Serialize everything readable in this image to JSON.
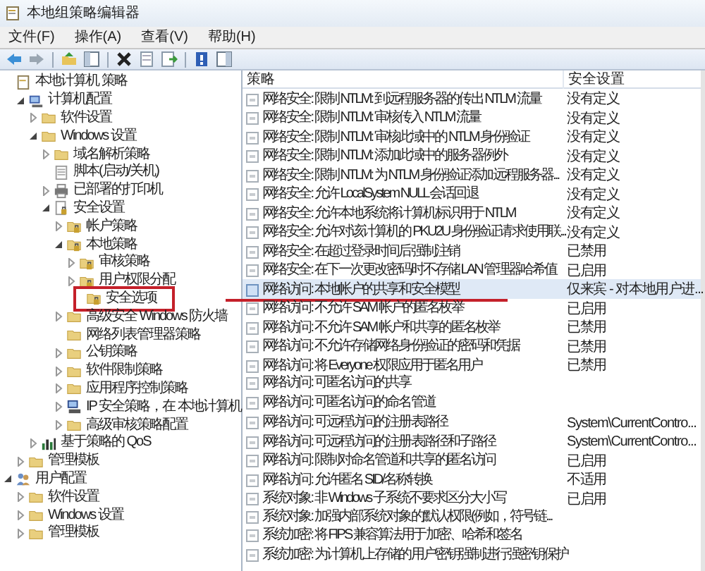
{
  "window": {
    "title": "本地组策略编辑器"
  },
  "menu": [
    "文件(F)",
    "操作(A)",
    "查看(V)",
    "帮助(H)"
  ],
  "toolbar": [
    {
      "kind": "back"
    },
    {
      "kind": "forward"
    },
    {
      "kind": "sep"
    },
    {
      "kind": "up"
    },
    {
      "kind": "tree"
    },
    {
      "kind": "sep"
    },
    {
      "kind": "delete"
    },
    {
      "kind": "properties"
    },
    {
      "kind": "export"
    },
    {
      "kind": "sep"
    },
    {
      "kind": "help"
    },
    {
      "kind": "pane"
    }
  ],
  "tree": [
    {
      "label": "本地计算机 策略",
      "kind": "root",
      "children": [
        {
          "label": "计算机配置",
          "kind": "computer",
          "expanded": true,
          "children": [
            {
              "label": "软件设置",
              "kind": "folder",
              "expanded": false
            },
            {
              "label": "Windows 设置",
              "kind": "folder",
              "expanded": true,
              "children": [
                {
                  "label": "域名解析策略",
                  "kind": "folder",
                  "expanded": false
                },
                {
                  "label": "脚本(启动/关机)",
                  "kind": "script"
                },
                {
                  "label": "已部署的打印机",
                  "kind": "printer",
                  "expanded": false
                },
                {
                  "label": "安全设置",
                  "kind": "secure",
                  "expanded": true,
                  "children": [
                    {
                      "label": "帐户策略",
                      "kind": "secure-folder",
                      "expanded": false
                    },
                    {
                      "label": "本地策略",
                      "kind": "secure-folder",
                      "expanded": true,
                      "children": [
                        {
                          "label": "审核策略",
                          "kind": "secure-folder",
                          "expanded": false
                        },
                        {
                          "label": "用户权限分配",
                          "kind": "secure-folder",
                          "expanded": false
                        },
                        {
                          "label": "安全选项",
                          "kind": "secure-folder",
                          "annotated": true
                        }
                      ]
                    },
                    {
                      "label": "高级安全 Windows 防火墙",
                      "kind": "folder",
                      "expanded": false
                    },
                    {
                      "label": "网络列表管理器策略",
                      "kind": "folder"
                    },
                    {
                      "label": "公钥策略",
                      "kind": "folder",
                      "expanded": false
                    },
                    {
                      "label": "软件限制策略",
                      "kind": "folder",
                      "expanded": false
                    },
                    {
                      "label": "应用程序控制策略",
                      "kind": "folder",
                      "expanded": false
                    },
                    {
                      "label": "IP 安全策略，在 本地计算机",
                      "kind": "network",
                      "expanded": false
                    },
                    {
                      "label": "高级审核策略配置",
                      "kind": "folder",
                      "expanded": false
                    }
                  ]
                }
              ]
            },
            {
              "label": "基于策略的 QoS",
              "kind": "chart",
              "expanded": false
            }
          ]
        },
        {
          "label": "管理模板",
          "kind": "folder",
          "expanded": false
        }
      ]
    },
    {
      "label": "用户配置",
      "kind": "user",
      "expanded": true,
      "children": [
        {
          "label": "软件设置",
          "kind": "folder",
          "expanded": false
        },
        {
          "label": "Windows 设置",
          "kind": "folder",
          "expanded": false
        },
        {
          "label": "管理模板",
          "kind": "folder",
          "expanded": false
        }
      ]
    }
  ],
  "table": {
    "columns": [
      "策略",
      "安全设置"
    ],
    "rows": [
      {
        "policy": "网络安全: 限制 NTLM: 到远程服务器的传出 NTLM 流量",
        "setting": "没有定义",
        "selected": false
      },
      {
        "policy": "网络安全: 限制 NTLM: 审核传入 NTLM 流量",
        "setting": "没有定义",
        "selected": false
      },
      {
        "policy": "网络安全: 限制 NTLM: 审核此域中的 NTLM 身份验证",
        "setting": "没有定义",
        "selected": false
      },
      {
        "policy": "网络安全: 限制 NTLM: 添加此域中的服务器例外",
        "setting": "没有定义",
        "selected": false
      },
      {
        "policy": "网络安全: 限制 NTLM: 为 NTLM 身份验证添加远程服务器...",
        "setting": "没有定义",
        "selected": false
      },
      {
        "policy": "网络安全: 允许 LocalSystem NULL 会话回退",
        "setting": "没有定义",
        "selected": false
      },
      {
        "policy": "网络安全: 允许本地系统将计算机标识用于 NTLM",
        "setting": "没有定义",
        "selected": false
      },
      {
        "policy": "网络安全: 允许对该计算机的 PKU2U 身份验证请求使用联...",
        "setting": "没有定义",
        "selected": false
      },
      {
        "policy": "网络安全: 在超过登录时间后强制注销",
        "setting": "已禁用",
        "selected": false
      },
      {
        "policy": "网络安全: 在下一次更改密码时不存储 LAN 管理器哈希值",
        "setting": "已启用",
        "selected": false
      },
      {
        "policy": "网络访问: 本地帐户的共享和安全模型",
        "setting": "仅来宾 - 对本地用户进...",
        "selected": true,
        "annotated": true
      },
      {
        "policy": "网络访问: 不允许 SAM 帐户的匿名枚举",
        "setting": "已启用",
        "selected": false
      },
      {
        "policy": "网络访问: 不允许 SAM 帐户和共享的匿名枚举",
        "setting": "已禁用",
        "selected": false
      },
      {
        "policy": "网络访问: 不允许存储网络身份验证的密码和凭据",
        "setting": "已禁用",
        "selected": false
      },
      {
        "policy": "网络访问: 将 Everyone 权限应用于匿名用户",
        "setting": "已禁用",
        "selected": false
      },
      {
        "policy": "网络访问: 可匿名访问的共享",
        "selected": false
      },
      {
        "policy": "网络访问: 可匿名访问的命名管道",
        "selected": false
      },
      {
        "policy": "网络访问: 可远程访问的注册表路径",
        "setting": "System\\CurrentContro...",
        "selected": false
      },
      {
        "policy": "网络访问: 可远程访问的注册表路径和子路径",
        "setting": "System\\CurrentContro...",
        "selected": false
      },
      {
        "policy": "网络访问: 限制对命名管道和共享的匿名访问",
        "setting": "已启用",
        "selected": false
      },
      {
        "policy": "网络访问: 允许匿名 SID/名称转换",
        "setting": "不适用",
        "selected": false
      },
      {
        "policy": "系统对象: 非 Windows 子系统不要求区分大小写",
        "setting": "已启用",
        "selected": false
      },
      {
        "policy": "系统对象: 加强内部系统对象的默认权限(例如，符号链...",
        "selected": false
      },
      {
        "policy": "系统加密: 将 FIPS 兼容算法用于加密、哈希和签名",
        "selected": false
      },
      {
        "policy": "系统加密: 为计算机上存储的用户密钥强制进行强密钥保护",
        "selected": false
      }
    ]
  }
}
